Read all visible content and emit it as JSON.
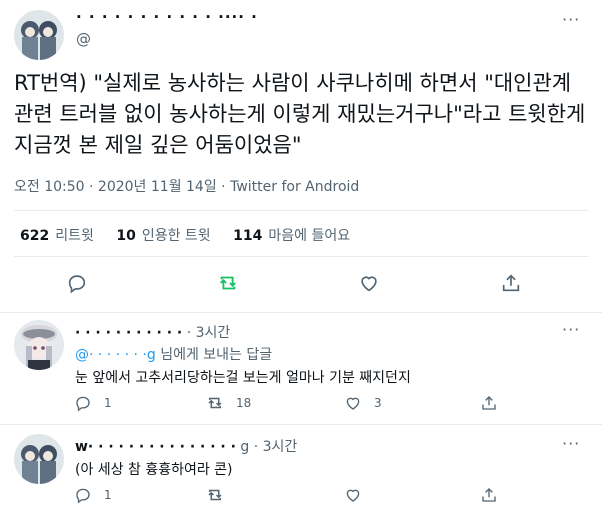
{
  "tweet": {
    "author_name": "·  · · ·  ·  · · · ·  ·  ·  ···· ·",
    "author_handle": "@",
    "more_label": "···",
    "text": "RT번역) \"실제로 농사하는 사람이 사쿠나히메 하면서 \"대인관계 관련 트러블 없이 농사하는게 이렇게 재밌는거구나\"라고 트윗한게 지금껏 본 제일 깊은 어둠이었음\"",
    "time": "오전 10:50",
    "sep1": " · ",
    "date": "2020년 11월 14일",
    "sep2": " · ",
    "source": "Twitter for Android",
    "stats": {
      "retweets_count": "622",
      "retweets_label": "리트윗",
      "quotes_count": "10",
      "quotes_label": "인용한 트윗",
      "likes_count": "114",
      "likes_label": "마음에 들어요"
    },
    "icons": [
      "reply-icon",
      "retweet-icon",
      "like-icon",
      "share-icon"
    ]
  },
  "replies": [
    {
      "name": "· ·          · · · · ·  ·  ·   ·  ·",
      "time": "· 3시간",
      "replying_handle": "@· · · ·   · · ·g",
      "replying_suffix": "님에게 보내는 답글",
      "text": "눈 앞에서 고추서리당하는걸 보는게 얼마나 기분 째지던지",
      "reply_count": "1",
      "retweet_count": "18",
      "like_count": "3"
    },
    {
      "name": "w·  ·   ·  · ·  ·  · ·  · ·  ·  · ·   ·  ·",
      "time": "g · 3시간",
      "text": "(아 세상 참 흉흉하여라 콘)",
      "reply_count": "1",
      "retweet_count": "",
      "like_count": ""
    }
  ],
  "colors": {
    "text": "#0f1419",
    "secondary": "#536471",
    "link": "#1d9bf0",
    "retweet_green": "#17bf63",
    "divider": "#e6ecf0"
  }
}
